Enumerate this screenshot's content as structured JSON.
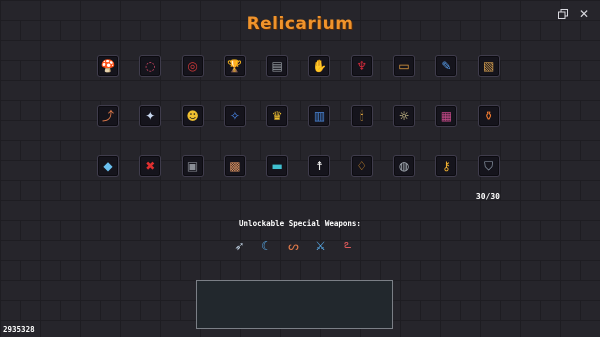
{
  "header": {
    "title": "Relicarium",
    "window_icon": "window-restore-icon",
    "close_glyph": "✕"
  },
  "relics": [
    {
      "name": "mushroom-relic-icon",
      "glyph": "🍄",
      "color": "#e07a3a"
    },
    {
      "name": "ring-of-beads-relic-icon",
      "glyph": "◌",
      "color": "#e04a6a"
    },
    {
      "name": "red-bracelet-relic-icon",
      "glyph": "◎",
      "color": "#d03a3a"
    },
    {
      "name": "golden-chalice-relic-icon",
      "glyph": "🏆",
      "color": "#f0c030"
    },
    {
      "name": "stone-tablet-relic-icon",
      "glyph": "▤",
      "color": "#9aa0a6"
    },
    {
      "name": "fire-hand-relic-icon",
      "glyph": "✋",
      "color": "#f07a30"
    },
    {
      "name": "red-demon-relic-icon",
      "glyph": "♆",
      "color": "#d02a3a"
    },
    {
      "name": "treasure-scroll-relic-icon",
      "glyph": "▭",
      "color": "#e8a040"
    },
    {
      "name": "blue-feather-relic-icon",
      "glyph": "✎",
      "color": "#5aa0f0"
    },
    {
      "name": "parchment-relic-icon",
      "glyph": "▧",
      "color": "#d8a050"
    },
    {
      "name": "leaping-foot-relic-icon",
      "glyph": "⤴",
      "color": "#e07a4a"
    },
    {
      "name": "white-wings-relic-icon",
      "glyph": "✦",
      "color": "#c8d8f0"
    },
    {
      "name": "golden-idol-relic-icon",
      "glyph": "☻",
      "color": "#f0c030"
    },
    {
      "name": "blue-fairy-relic-icon",
      "glyph": "✧",
      "color": "#4a8af0"
    },
    {
      "name": "golden-crown-relic-icon",
      "glyph": "♛",
      "color": "#f0c030"
    },
    {
      "name": "spellbook-relic-icon",
      "glyph": "▥",
      "color": "#4a8ae0"
    },
    {
      "name": "lit-candle-relic-icon",
      "glyph": "🕯",
      "color": "#f0b040"
    },
    {
      "name": "sun-medallion-relic-icon",
      "glyph": "☼",
      "color": "#f0e0a0"
    },
    {
      "name": "striped-tome-relic-icon",
      "glyph": "▦",
      "color": "#c84a8a"
    },
    {
      "name": "potion-jar-relic-icon",
      "glyph": "⚱",
      "color": "#f07a30"
    },
    {
      "name": "blue-gem-relic-icon",
      "glyph": "◆",
      "color": "#6ac0f0"
    },
    {
      "name": "red-sigil-relic-icon",
      "glyph": "✖",
      "color": "#e03030"
    },
    {
      "name": "grey-bucket-relic-icon",
      "glyph": "▣",
      "color": "#8a8e96"
    },
    {
      "name": "wooden-crate-relic-icon",
      "glyph": "▩",
      "color": "#d89060"
    },
    {
      "name": "cyan-banner-relic-icon",
      "glyph": "▬",
      "color": "#40c0d0"
    },
    {
      "name": "stick-figure-relic-icon",
      "glyph": "☨",
      "color": "#e8e8e8"
    },
    {
      "name": "gold-sack-relic-icon",
      "glyph": "♢",
      "color": "#f0a030"
    },
    {
      "name": "silver-coin-relic-icon",
      "glyph": "◍",
      "color": "#b0b8c0"
    },
    {
      "name": "golden-key-relic-icon",
      "glyph": "⚷",
      "color": "#f0b030"
    },
    {
      "name": "silver-shield-relic-icon",
      "glyph": "⛉",
      "color": "#9aa8b8"
    }
  ],
  "relic_count": "30/30",
  "special_weapons": {
    "title": "Unlockable Special Weapons:",
    "items": [
      {
        "name": "spear-weapon-icon",
        "glyph": "➶",
        "color": "#b8c8d8"
      },
      {
        "name": "scythe-weapon-icon",
        "glyph": "☾",
        "color": "#5ab0f0"
      },
      {
        "name": "whip-weapon-icon",
        "glyph": "ᔕ",
        "color": "#e07a4a"
      },
      {
        "name": "crossed-swords-weapon-icon",
        "glyph": "⚔",
        "color": "#5ab0f0"
      },
      {
        "name": "chain-weapon-icon",
        "glyph": "ఽ",
        "color": "#e05a5a"
      }
    ]
  },
  "gold_amount": "2935328"
}
